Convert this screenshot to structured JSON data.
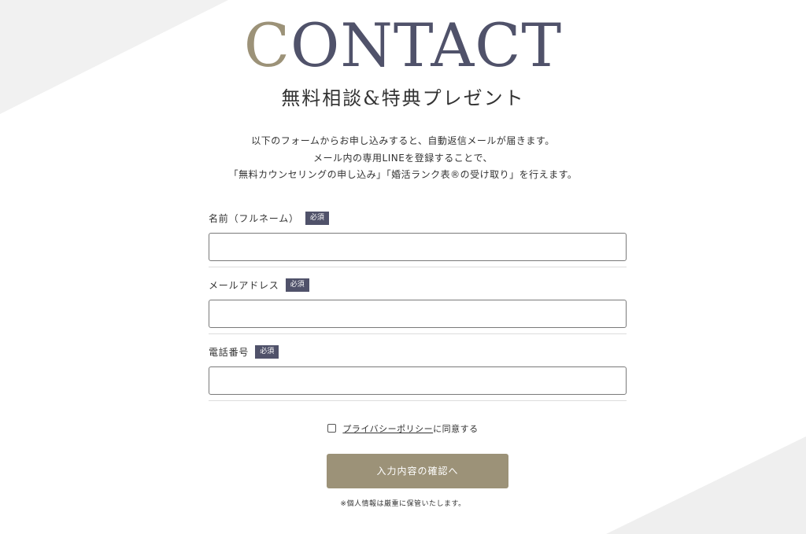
{
  "header": {
    "title_first_letter": "C",
    "title_rest": "ONTACT",
    "subtitle": "無料相談&特典プレゼント"
  },
  "intro": {
    "lines": [
      "以下のフォームからお申し込みすると、自動返信メールが届きます。",
      "メール内の専用LINEを登録することで、",
      "「無料カウンセリングの申し込み」「婚活ランク表®の受け取り」を行えます。"
    ]
  },
  "form": {
    "fields": [
      {
        "label": "名前（フルネーム）",
        "required_badge": "必須",
        "value": "",
        "placeholder": ""
      },
      {
        "label": "メールアドレス",
        "required_badge": "必須",
        "value": "",
        "placeholder": ""
      },
      {
        "label": "電話番号",
        "required_badge": "必須",
        "value": "",
        "placeholder": ""
      }
    ],
    "consent": {
      "checked": false,
      "link_text": "プライバシーポリシー",
      "suffix_text": "に同意する"
    },
    "submit_label": "入力内容の確認へ",
    "note": "※個人情報は厳重に保管いたします。"
  },
  "colors": {
    "accent_gold": "#9c9278",
    "navy": "#50526a",
    "text": "#333333"
  },
  "icons": {
    "consent_checkbox": "checkbox-icon"
  }
}
